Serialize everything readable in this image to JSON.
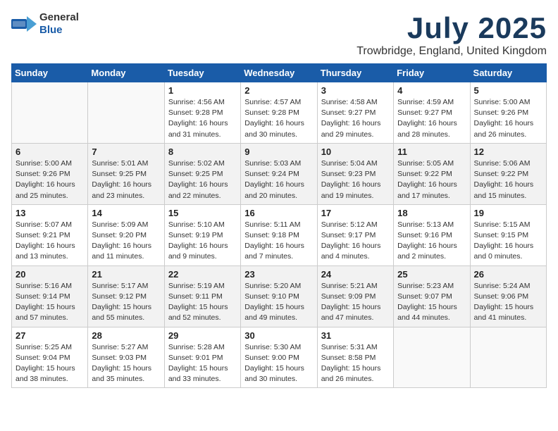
{
  "header": {
    "logo_general": "General",
    "logo_blue": "Blue",
    "month": "July 2025",
    "location": "Trowbridge, England, United Kingdom"
  },
  "days_of_week": [
    "Sunday",
    "Monday",
    "Tuesday",
    "Wednesday",
    "Thursday",
    "Friday",
    "Saturday"
  ],
  "weeks": [
    [
      {
        "day": "",
        "info": ""
      },
      {
        "day": "",
        "info": ""
      },
      {
        "day": "1",
        "info": "Sunrise: 4:56 AM\nSunset: 9:28 PM\nDaylight: 16 hours\nand 31 minutes."
      },
      {
        "day": "2",
        "info": "Sunrise: 4:57 AM\nSunset: 9:28 PM\nDaylight: 16 hours\nand 30 minutes."
      },
      {
        "day": "3",
        "info": "Sunrise: 4:58 AM\nSunset: 9:27 PM\nDaylight: 16 hours\nand 29 minutes."
      },
      {
        "day": "4",
        "info": "Sunrise: 4:59 AM\nSunset: 9:27 PM\nDaylight: 16 hours\nand 28 minutes."
      },
      {
        "day": "5",
        "info": "Sunrise: 5:00 AM\nSunset: 9:26 PM\nDaylight: 16 hours\nand 26 minutes."
      }
    ],
    [
      {
        "day": "6",
        "info": "Sunrise: 5:00 AM\nSunset: 9:26 PM\nDaylight: 16 hours\nand 25 minutes."
      },
      {
        "day": "7",
        "info": "Sunrise: 5:01 AM\nSunset: 9:25 PM\nDaylight: 16 hours\nand 23 minutes."
      },
      {
        "day": "8",
        "info": "Sunrise: 5:02 AM\nSunset: 9:25 PM\nDaylight: 16 hours\nand 22 minutes."
      },
      {
        "day": "9",
        "info": "Sunrise: 5:03 AM\nSunset: 9:24 PM\nDaylight: 16 hours\nand 20 minutes."
      },
      {
        "day": "10",
        "info": "Sunrise: 5:04 AM\nSunset: 9:23 PM\nDaylight: 16 hours\nand 19 minutes."
      },
      {
        "day": "11",
        "info": "Sunrise: 5:05 AM\nSunset: 9:22 PM\nDaylight: 16 hours\nand 17 minutes."
      },
      {
        "day": "12",
        "info": "Sunrise: 5:06 AM\nSunset: 9:22 PM\nDaylight: 16 hours\nand 15 minutes."
      }
    ],
    [
      {
        "day": "13",
        "info": "Sunrise: 5:07 AM\nSunset: 9:21 PM\nDaylight: 16 hours\nand 13 minutes."
      },
      {
        "day": "14",
        "info": "Sunrise: 5:09 AM\nSunset: 9:20 PM\nDaylight: 16 hours\nand 11 minutes."
      },
      {
        "day": "15",
        "info": "Sunrise: 5:10 AM\nSunset: 9:19 PM\nDaylight: 16 hours\nand 9 minutes."
      },
      {
        "day": "16",
        "info": "Sunrise: 5:11 AM\nSunset: 9:18 PM\nDaylight: 16 hours\nand 7 minutes."
      },
      {
        "day": "17",
        "info": "Sunrise: 5:12 AM\nSunset: 9:17 PM\nDaylight: 16 hours\nand 4 minutes."
      },
      {
        "day": "18",
        "info": "Sunrise: 5:13 AM\nSunset: 9:16 PM\nDaylight: 16 hours\nand 2 minutes."
      },
      {
        "day": "19",
        "info": "Sunrise: 5:15 AM\nSunset: 9:15 PM\nDaylight: 16 hours\nand 0 minutes."
      }
    ],
    [
      {
        "day": "20",
        "info": "Sunrise: 5:16 AM\nSunset: 9:14 PM\nDaylight: 15 hours\nand 57 minutes."
      },
      {
        "day": "21",
        "info": "Sunrise: 5:17 AM\nSunset: 9:12 PM\nDaylight: 15 hours\nand 55 minutes."
      },
      {
        "day": "22",
        "info": "Sunrise: 5:19 AM\nSunset: 9:11 PM\nDaylight: 15 hours\nand 52 minutes."
      },
      {
        "day": "23",
        "info": "Sunrise: 5:20 AM\nSunset: 9:10 PM\nDaylight: 15 hours\nand 49 minutes."
      },
      {
        "day": "24",
        "info": "Sunrise: 5:21 AM\nSunset: 9:09 PM\nDaylight: 15 hours\nand 47 minutes."
      },
      {
        "day": "25",
        "info": "Sunrise: 5:23 AM\nSunset: 9:07 PM\nDaylight: 15 hours\nand 44 minutes."
      },
      {
        "day": "26",
        "info": "Sunrise: 5:24 AM\nSunset: 9:06 PM\nDaylight: 15 hours\nand 41 minutes."
      }
    ],
    [
      {
        "day": "27",
        "info": "Sunrise: 5:25 AM\nSunset: 9:04 PM\nDaylight: 15 hours\nand 38 minutes."
      },
      {
        "day": "28",
        "info": "Sunrise: 5:27 AM\nSunset: 9:03 PM\nDaylight: 15 hours\nand 35 minutes."
      },
      {
        "day": "29",
        "info": "Sunrise: 5:28 AM\nSunset: 9:01 PM\nDaylight: 15 hours\nand 33 minutes."
      },
      {
        "day": "30",
        "info": "Sunrise: 5:30 AM\nSunset: 9:00 PM\nDaylight: 15 hours\nand 30 minutes."
      },
      {
        "day": "31",
        "info": "Sunrise: 5:31 AM\nSunset: 8:58 PM\nDaylight: 15 hours\nand 26 minutes."
      },
      {
        "day": "",
        "info": ""
      },
      {
        "day": "",
        "info": ""
      }
    ]
  ]
}
